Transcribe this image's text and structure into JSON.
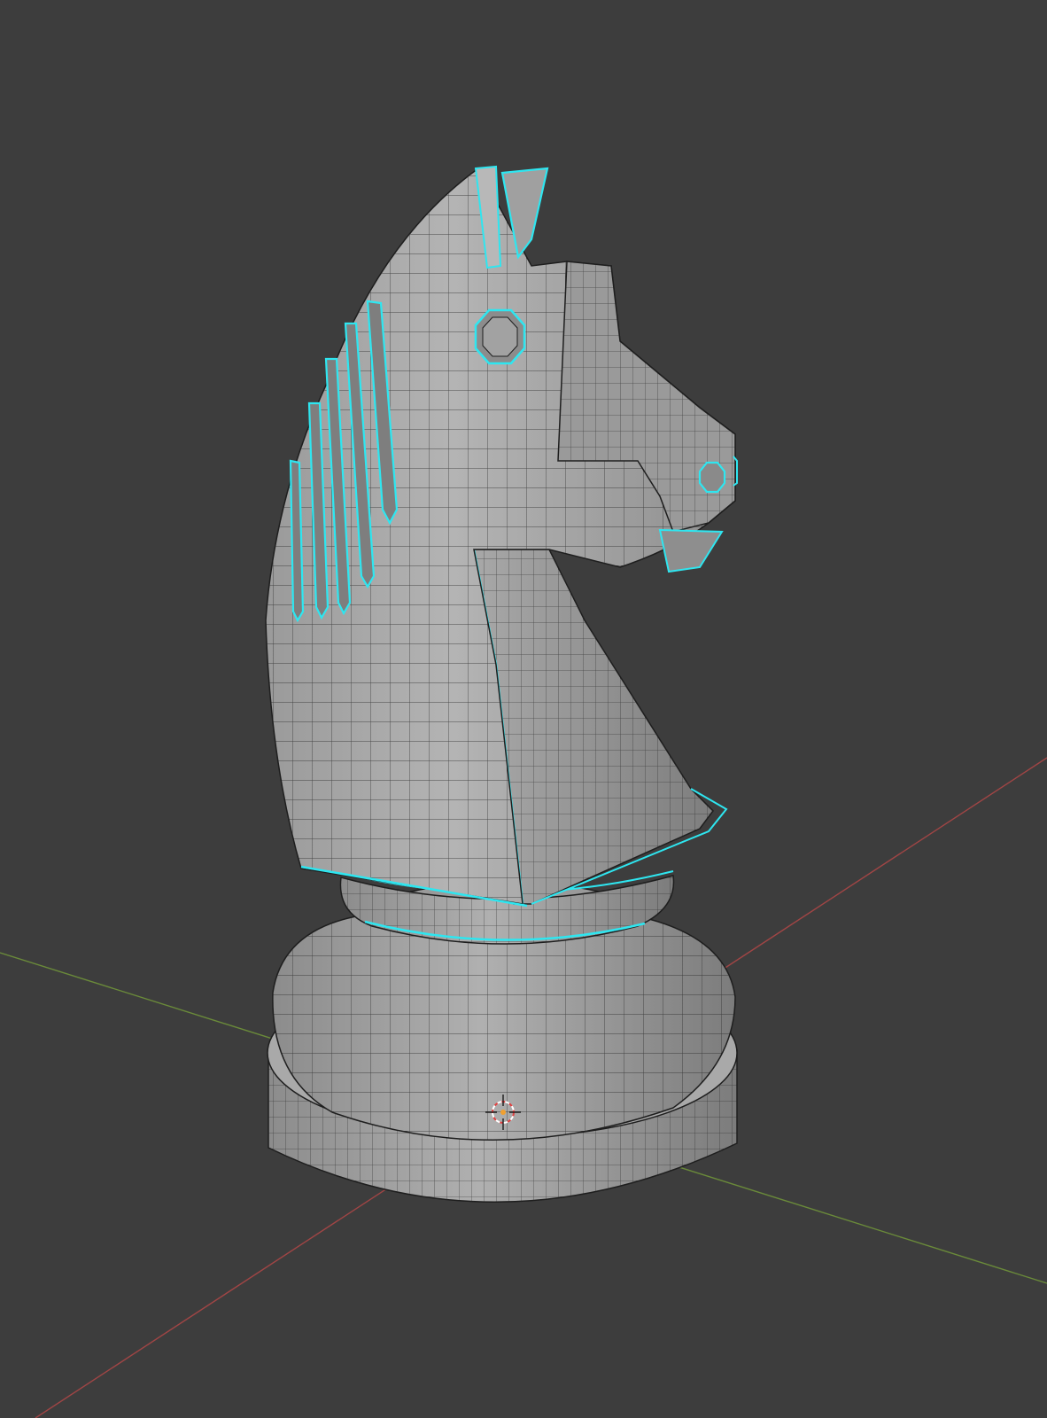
{
  "viewport": {
    "background": "#3d3d3d",
    "grid_axes": {
      "x_axis_color": "#a04545",
      "y_axis_color": "#6a8a3a"
    },
    "selection_color": "#2ee6f0",
    "mesh_color": "#a6a6a6",
    "wire_color": "#202020"
  },
  "object": {
    "kind": "chess-knight-mesh",
    "edit_mode": true,
    "selection_highlight": "cyan seams"
  },
  "cursor_3d": {
    "icon": "3d-cursor-icon",
    "colors": [
      "#e04040",
      "#ffffff"
    ]
  }
}
